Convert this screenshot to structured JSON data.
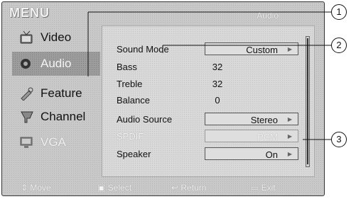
{
  "menu": {
    "title": "MENU",
    "section": "Audio"
  },
  "nav": {
    "items": [
      {
        "label": "Video",
        "icon": "video-icon"
      },
      {
        "label": "Audio",
        "icon": "audio-icon",
        "active": true
      },
      {
        "label": "Feature",
        "icon": "feature-icon"
      },
      {
        "label": "Channel",
        "icon": "channel-icon"
      },
      {
        "label": "VGA",
        "icon": "vga-icon",
        "dim": true
      }
    ]
  },
  "settings": {
    "rows": [
      {
        "label": "Sound Mode",
        "value": "Custom",
        "type": "select"
      },
      {
        "label": "Bass",
        "value": "32",
        "type": "number"
      },
      {
        "label": "Treble",
        "value": "32",
        "type": "number"
      },
      {
        "label": "Balance",
        "value": "0",
        "type": "number"
      },
      {
        "label": "Audio Source",
        "value": "Stereo",
        "type": "select"
      },
      {
        "label": "SPDIF",
        "value": "PCM",
        "type": "select",
        "dim": true
      },
      {
        "label": "Speaker",
        "value": "On",
        "type": "select"
      }
    ]
  },
  "footer": {
    "move": "Move",
    "select": "Select",
    "return": "Return",
    "exit": "Exit"
  },
  "callouts": [
    "1",
    "2",
    "3"
  ]
}
